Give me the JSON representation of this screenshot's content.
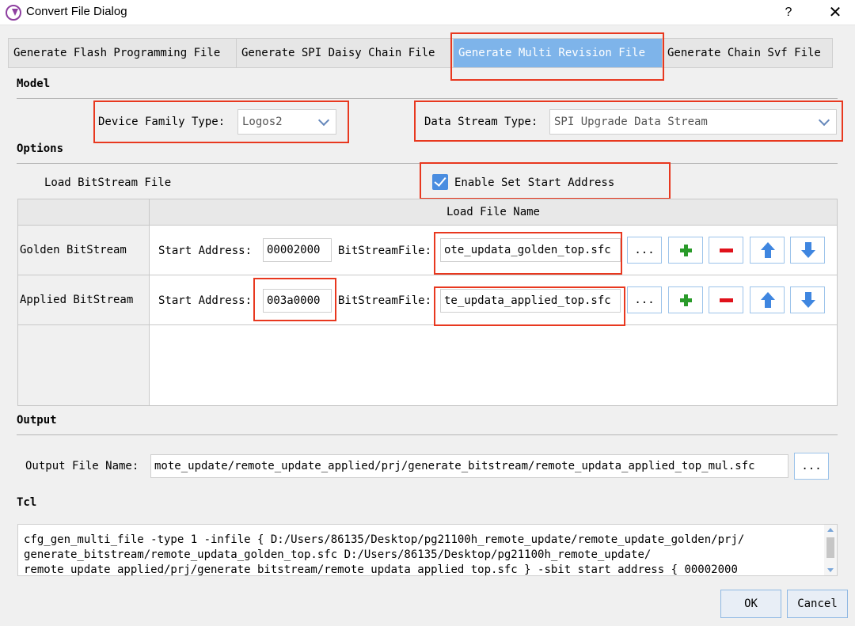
{
  "window": {
    "title": "Convert File Dialog",
    "help": "?",
    "close": "✕"
  },
  "tabs": [
    {
      "label": "Generate Flash Programming File"
    },
    {
      "label": "Generate SPI Daisy Chain File"
    },
    {
      "label": "Generate Multi Revision File"
    },
    {
      "label": "Generate Chain Svf File"
    }
  ],
  "model": {
    "section": "Model",
    "device_family_label": "Device Family Type:",
    "device_family_value": "Logos2",
    "data_stream_label": "Data Stream Type:",
    "data_stream_value": "SPI Upgrade Data Stream"
  },
  "options": {
    "section": "Options",
    "load_bitstream": "Load BitStream File",
    "enable_start_address": "Enable Set Start Address",
    "enable_start_address_checked": true
  },
  "grid": {
    "column_header": "Load File Name",
    "rows": [
      {
        "name": "Golden BitStream",
        "start_label": "Start Address:",
        "start_value": "00002000",
        "file_label": "BitStreamFile:",
        "file_value": "ote_updata_golden_top.sfc",
        "browse": "..."
      },
      {
        "name": "Applied BitStream",
        "start_label": "Start Address:",
        "start_value": "003a0000",
        "file_label": "BitStreamFile:",
        "file_value": "te_updata_applied_top.sfc",
        "browse": "..."
      }
    ]
  },
  "output": {
    "section": "Output",
    "file_label": "Output File Name:",
    "file_value": "mote_update/remote_update_applied/prj/generate_bitstream/remote_updata_applied_top_mul.sfc",
    "browse": "..."
  },
  "tcl": {
    "section": "Tcl",
    "lines": [
      "cfg_gen_multi_file -type 1 -infile {  D:/Users/86135/Desktop/pg21100h_remote_update/remote_update_golden/prj/",
      "generate_bitstream/remote_updata_golden_top.sfc D:/Users/86135/Desktop/pg21100h_remote_update/",
      "remote_update_applied/prj/generate_bitstream/remote_updata_applied_top.sfc } -sbit_start_address {  00002000"
    ]
  },
  "footer": {
    "ok": "OK",
    "cancel": "Cancel"
  },
  "colors": {
    "active_tab": "#7eb4ea",
    "highlight_box": "#e8381f",
    "add_icon": "#2a9a2a",
    "remove_icon": "#e0121b",
    "arrow_icon": "#3f86e0"
  }
}
